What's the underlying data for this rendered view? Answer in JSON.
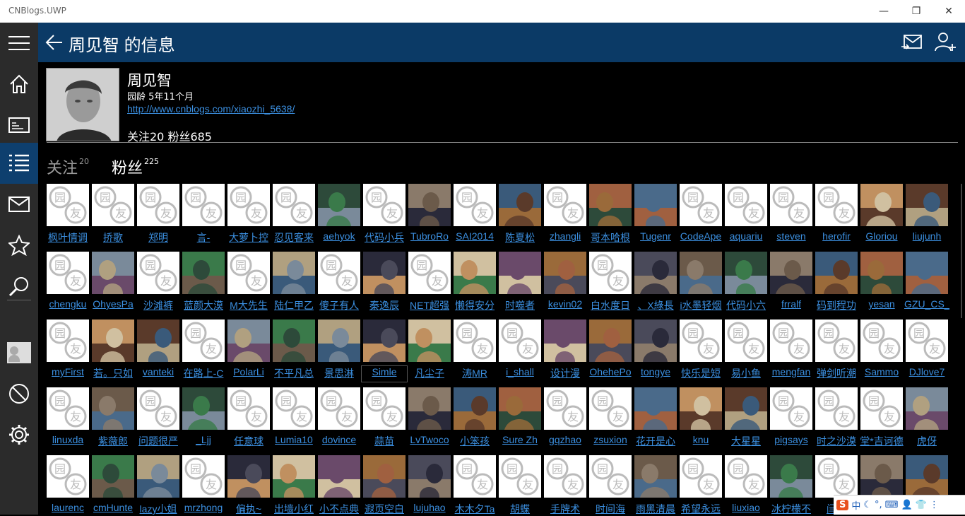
{
  "window": {
    "title": "CNBlogs.UWP",
    "minimize": "—",
    "restore": "❐",
    "close": "✕"
  },
  "header": {
    "title": "周见智 的信息"
  },
  "profile": {
    "name": "周见智",
    "age": "园龄 5年11个月",
    "url": "http://www.cnblogs.com/xiaozhi_5638/",
    "counts": "关注20  粉丝685"
  },
  "tabs": [
    {
      "label": "关注",
      "count": "20"
    },
    {
      "label": "粉丝",
      "count": "225"
    }
  ],
  "colors": {
    "header": "#0b3a66",
    "sidebar": "#2b2b2b",
    "link": "#3b8fe0",
    "active_nav": "#0e3f6e"
  },
  "nav": [
    "hamburger-icon",
    "home-icon",
    "news-icon",
    "list-icon",
    "mail-icon",
    "star-icon",
    "search-icon",
    "user-avatar",
    "block-icon",
    "gear-icon"
  ],
  "tray": {
    "ime": "中",
    "items": [
      "S",
      "中",
      "☾",
      "°,",
      "⌨",
      "👤",
      "👕",
      "⋮"
    ]
  },
  "followers": [
    [
      {
        "n": "枫叶情调",
        "a": "d"
      },
      {
        "n": "挢歌",
        "a": "d"
      },
      {
        "n": "郑明",
        "a": "d"
      },
      {
        "n": "言-",
        "a": "d"
      },
      {
        "n": "大萝卜控",
        "a": "d"
      },
      {
        "n": "忍见客来",
        "a": "d"
      },
      {
        "n": "aehyok",
        "a": "p1"
      },
      {
        "n": "代码小兵",
        "a": "d"
      },
      {
        "n": "TubroRo",
        "a": "p2"
      },
      {
        "n": "SAI2014",
        "a": "d"
      },
      {
        "n": "陈夏松",
        "a": "p3"
      },
      {
        "n": "zhangli",
        "a": "d"
      },
      {
        "n": "哥本哈根",
        "a": "p4"
      },
      {
        "n": "Tugenr",
        "a": "p5"
      },
      {
        "n": "CodeApe",
        "a": "d"
      },
      {
        "n": "aquariu",
        "a": "d"
      },
      {
        "n": "steven",
        "a": "d"
      },
      {
        "n": "herofir",
        "a": "d"
      },
      {
        "n": "Gloriou",
        "a": "p6"
      },
      {
        "n": "liujunh",
        "a": "p7"
      }
    ],
    [
      {
        "n": "chengku",
        "a": "d"
      },
      {
        "n": "OhyesPa",
        "a": "p8"
      },
      {
        "n": "沙滩裤",
        "a": "d"
      },
      {
        "n": "蓝颜大漠",
        "a": "p9"
      },
      {
        "n": "M大先生",
        "a": "d"
      },
      {
        "n": "陆仁甲乙",
        "a": "p10"
      },
      {
        "n": "傻子有人",
        "a": "d"
      },
      {
        "n": "秦逸辰",
        "a": "p11"
      },
      {
        "n": "NET超强",
        "a": "d"
      },
      {
        "n": "懒得安分",
        "a": "p12"
      },
      {
        "n": "时噬者",
        "a": "p13"
      },
      {
        "n": "kevin02",
        "a": "p14"
      },
      {
        "n": "白水度日",
        "a": "d"
      },
      {
        "n": "、X綠長",
        "a": "p15"
      },
      {
        "n": "i水墨轻烟",
        "a": "p16"
      },
      {
        "n": "代码小六",
        "a": "p17"
      },
      {
        "n": "frralf",
        "a": "p18"
      },
      {
        "n": "码到程功",
        "a": "p19"
      },
      {
        "n": "yesan",
        "a": "p20"
      },
      {
        "n": "GZU_CS_",
        "a": "p21"
      }
    ],
    [
      {
        "n": "myFirst",
        "a": "d"
      },
      {
        "n": "若。只如",
        "a": "p22"
      },
      {
        "n": "vanteki",
        "a": "p23"
      },
      {
        "n": "在路上-C",
        "a": "d"
      },
      {
        "n": "PolarLi",
        "a": "p24"
      },
      {
        "n": "不平凡总",
        "a": "p25"
      },
      {
        "n": "景思淋",
        "a": "p26"
      },
      {
        "n": "Simle",
        "a": "p27"
      },
      {
        "n": "凡尘子",
        "a": "p28"
      },
      {
        "n": "涛MR",
        "a": "d"
      },
      {
        "n": "i_shall",
        "a": "d"
      },
      {
        "n": "设计漫",
        "a": "p29"
      },
      {
        "n": "OhehePo",
        "a": "p30"
      },
      {
        "n": "tongye",
        "a": "p31"
      },
      {
        "n": "快乐是短",
        "a": "d"
      },
      {
        "n": "易小鱼",
        "a": "d"
      },
      {
        "n": "mengfan",
        "a": "d"
      },
      {
        "n": "弹剑听潮",
        "a": "d"
      },
      {
        "n": "Sammo",
        "a": "d"
      },
      {
        "n": "DJlove7",
        "a": "d"
      }
    ],
    [
      {
        "n": "linuxda",
        "a": "d"
      },
      {
        "n": "紫薇郎",
        "a": "p32"
      },
      {
        "n": "问题很严",
        "a": "d"
      },
      {
        "n": "_Ljj",
        "a": "p33"
      },
      {
        "n": "任意球",
        "a": "d"
      },
      {
        "n": "Lumia10",
        "a": "d"
      },
      {
        "n": "dovince",
        "a": "d"
      },
      {
        "n": "蒜苗",
        "a": "d"
      },
      {
        "n": "LvTwoco",
        "a": "p34"
      },
      {
        "n": "小笨孩",
        "a": "p35"
      },
      {
        "n": "Sure Zh",
        "a": "p36"
      },
      {
        "n": "gqzhao",
        "a": "d"
      },
      {
        "n": "zsuxion",
        "a": "d"
      },
      {
        "n": "花开是心",
        "a": "p37"
      },
      {
        "n": "knu",
        "a": "p38"
      },
      {
        "n": "大星星",
        "a": "p39"
      },
      {
        "n": "pigsays",
        "a": "d"
      },
      {
        "n": "时之沙漠",
        "a": "d"
      },
      {
        "n": "堂*吉诃德",
        "a": "d"
      },
      {
        "n": "虎伢",
        "a": "p40"
      }
    ],
    [
      {
        "n": "laurenc",
        "a": "d"
      },
      {
        "n": "cmHunte",
        "a": "p41"
      },
      {
        "n": "lazy小姐",
        "a": "p42"
      },
      {
        "n": "mrzhong",
        "a": "d"
      },
      {
        "n": "偏执~",
        "a": "p43"
      },
      {
        "n": "出墙小红",
        "a": "p44"
      },
      {
        "n": "小不点典",
        "a": "p45"
      },
      {
        "n": "遐页空白",
        "a": "p46"
      },
      {
        "n": "lujuhao",
        "a": "p47"
      },
      {
        "n": "木木夕Ta",
        "a": "d"
      },
      {
        "n": "胡蝶",
        "a": "d"
      },
      {
        "n": "手牌术",
        "a": "d"
      },
      {
        "n": "时间海",
        "a": "d"
      },
      {
        "n": "雨黑清晨",
        "a": "p48"
      },
      {
        "n": "希望永远",
        "a": "d"
      },
      {
        "n": "liuxiao",
        "a": "d"
      },
      {
        "n": "冰柠檬不",
        "a": "p49"
      },
      {
        "n": "闫旦",
        "a": "d"
      },
      {
        "n": "",
        "a": "p50"
      },
      {
        "n": "",
        "a": "p51"
      }
    ]
  ]
}
